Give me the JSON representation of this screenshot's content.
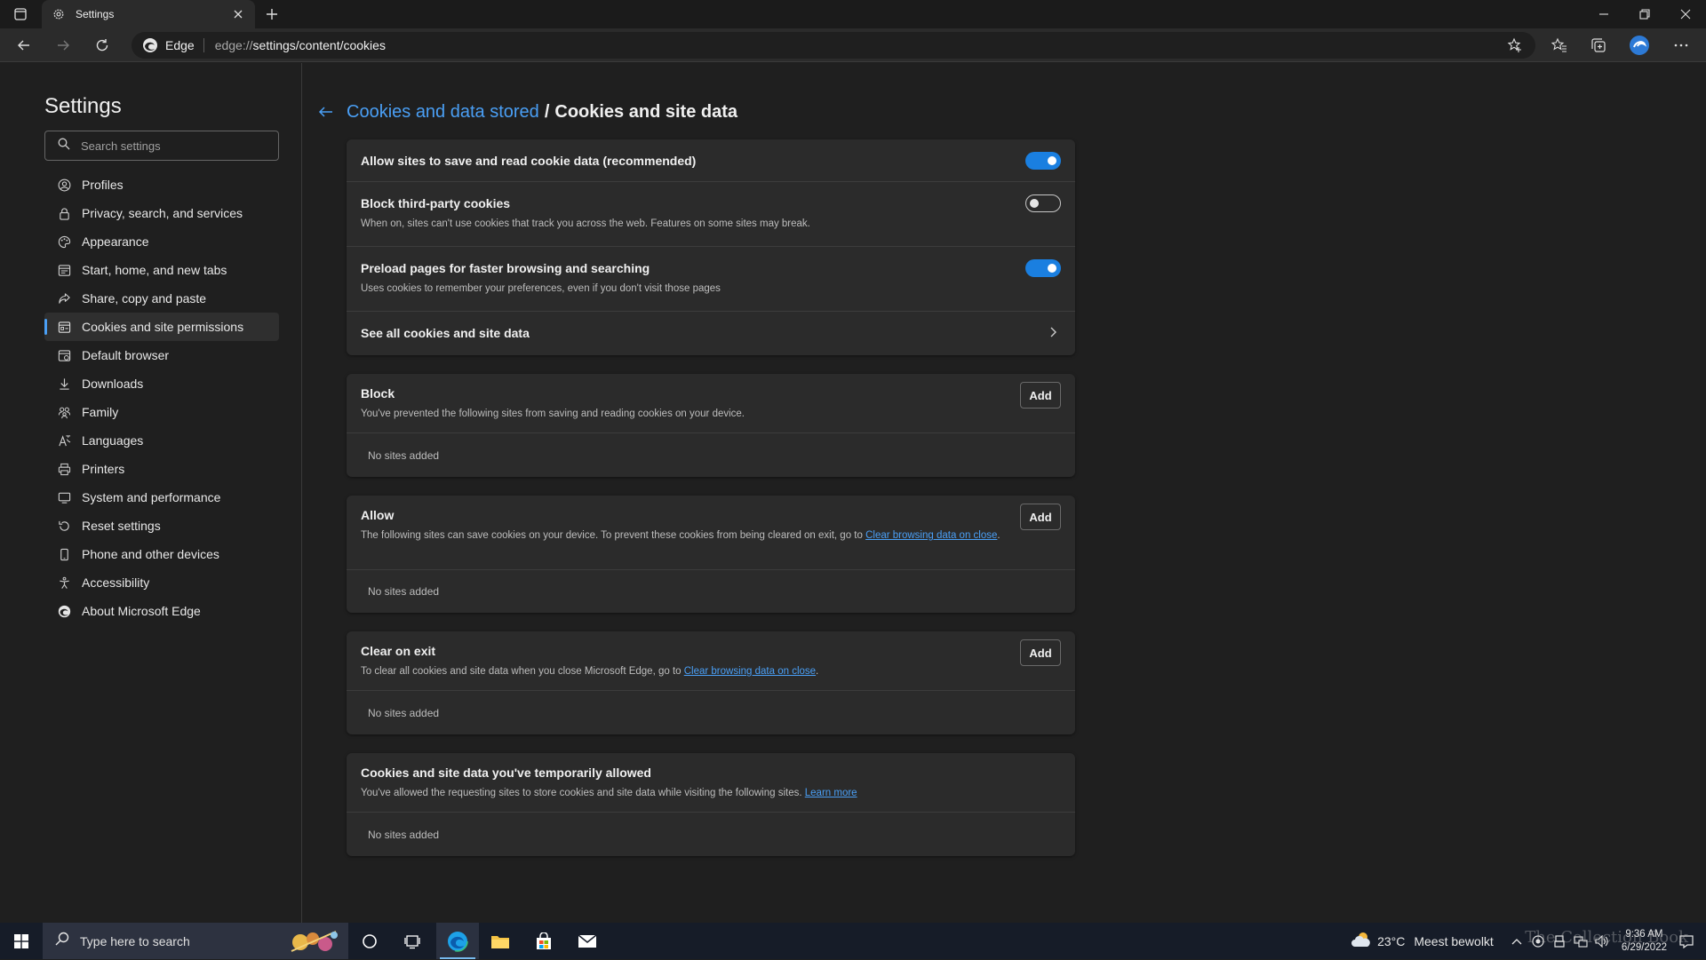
{
  "browser": {
    "tab_title": "Settings",
    "site_label": "Edge",
    "url_scheme": "edge://",
    "url_path": "settings/content/cookies"
  },
  "sidebar": {
    "title": "Settings",
    "search_placeholder": "Search settings",
    "items": [
      {
        "label": "Profiles",
        "icon": "profile-icon"
      },
      {
        "label": "Privacy, search, and services",
        "icon": "lock-icon"
      },
      {
        "label": "Appearance",
        "icon": "appearance-icon"
      },
      {
        "label": "Start, home, and new tabs",
        "icon": "start-tabs-icon"
      },
      {
        "label": "Share, copy and paste",
        "icon": "share-icon"
      },
      {
        "label": "Cookies and site permissions",
        "icon": "cookies-permissions-icon",
        "active": true
      },
      {
        "label": "Default browser",
        "icon": "default-browser-icon"
      },
      {
        "label": "Downloads",
        "icon": "download-icon"
      },
      {
        "label": "Family",
        "icon": "family-icon"
      },
      {
        "label": "Languages",
        "icon": "languages-icon"
      },
      {
        "label": "Printers",
        "icon": "printer-icon"
      },
      {
        "label": "System and performance",
        "icon": "system-icon"
      },
      {
        "label": "Reset settings",
        "icon": "reset-icon"
      },
      {
        "label": "Phone and other devices",
        "icon": "phone-icon"
      },
      {
        "label": "Accessibility",
        "icon": "accessibility-icon"
      },
      {
        "label": "About Microsoft Edge",
        "icon": "edge-logo-icon"
      }
    ]
  },
  "breadcrumb": {
    "parent": "Cookies and data stored",
    "separator": "/",
    "current": "Cookies and site data"
  },
  "settings": {
    "allow_cookies": {
      "title": "Allow sites to save and read cookie data (recommended)",
      "enabled": true
    },
    "block_third_party": {
      "title": "Block third-party cookies",
      "desc": "When on, sites can't use cookies that track you across the web. Features on some sites may break.",
      "enabled": false
    },
    "preload": {
      "title": "Preload pages for faster browsing and searching",
      "desc": "Uses cookies to remember your preferences, even if you don't visit those pages",
      "enabled": true
    },
    "see_all": {
      "title": "See all cookies and site data"
    }
  },
  "block": {
    "title": "Block",
    "desc": "You've prevented the following sites from saving and reading cookies on your device.",
    "add": "Add",
    "empty": "No sites added"
  },
  "allow": {
    "title": "Allow",
    "desc": "The following sites can save cookies on your device. To prevent these cookies from being cleared on exit, go to ",
    "link": "Clear browsing data on close",
    "desc_end": ".",
    "add": "Add",
    "empty": "No sites added"
  },
  "clear_on_exit": {
    "title": "Clear on exit",
    "desc": "To clear all cookies and site data when you close Microsoft Edge, go to ",
    "link": "Clear browsing data on close",
    "desc_end": ".",
    "add": "Add",
    "empty": "No sites added"
  },
  "temporary": {
    "title": "Cookies and site data you've temporarily allowed",
    "desc": "You've allowed the requesting sites to store cookies and site data while visiting the following sites. ",
    "link": "Learn more",
    "empty": "No sites added"
  },
  "taskbar": {
    "search_placeholder": "Type here to search",
    "temperature": "23°C",
    "weather_text": "Meest bewolkt",
    "time": "9:36 AM",
    "date": "6/29/2022"
  },
  "watermark": "The Collection Book",
  "colors": {
    "accent": "#4a9ff5",
    "toggle_on": "#1a7fe0",
    "background": "#1f1f1f",
    "card": "#2b2b2b"
  }
}
